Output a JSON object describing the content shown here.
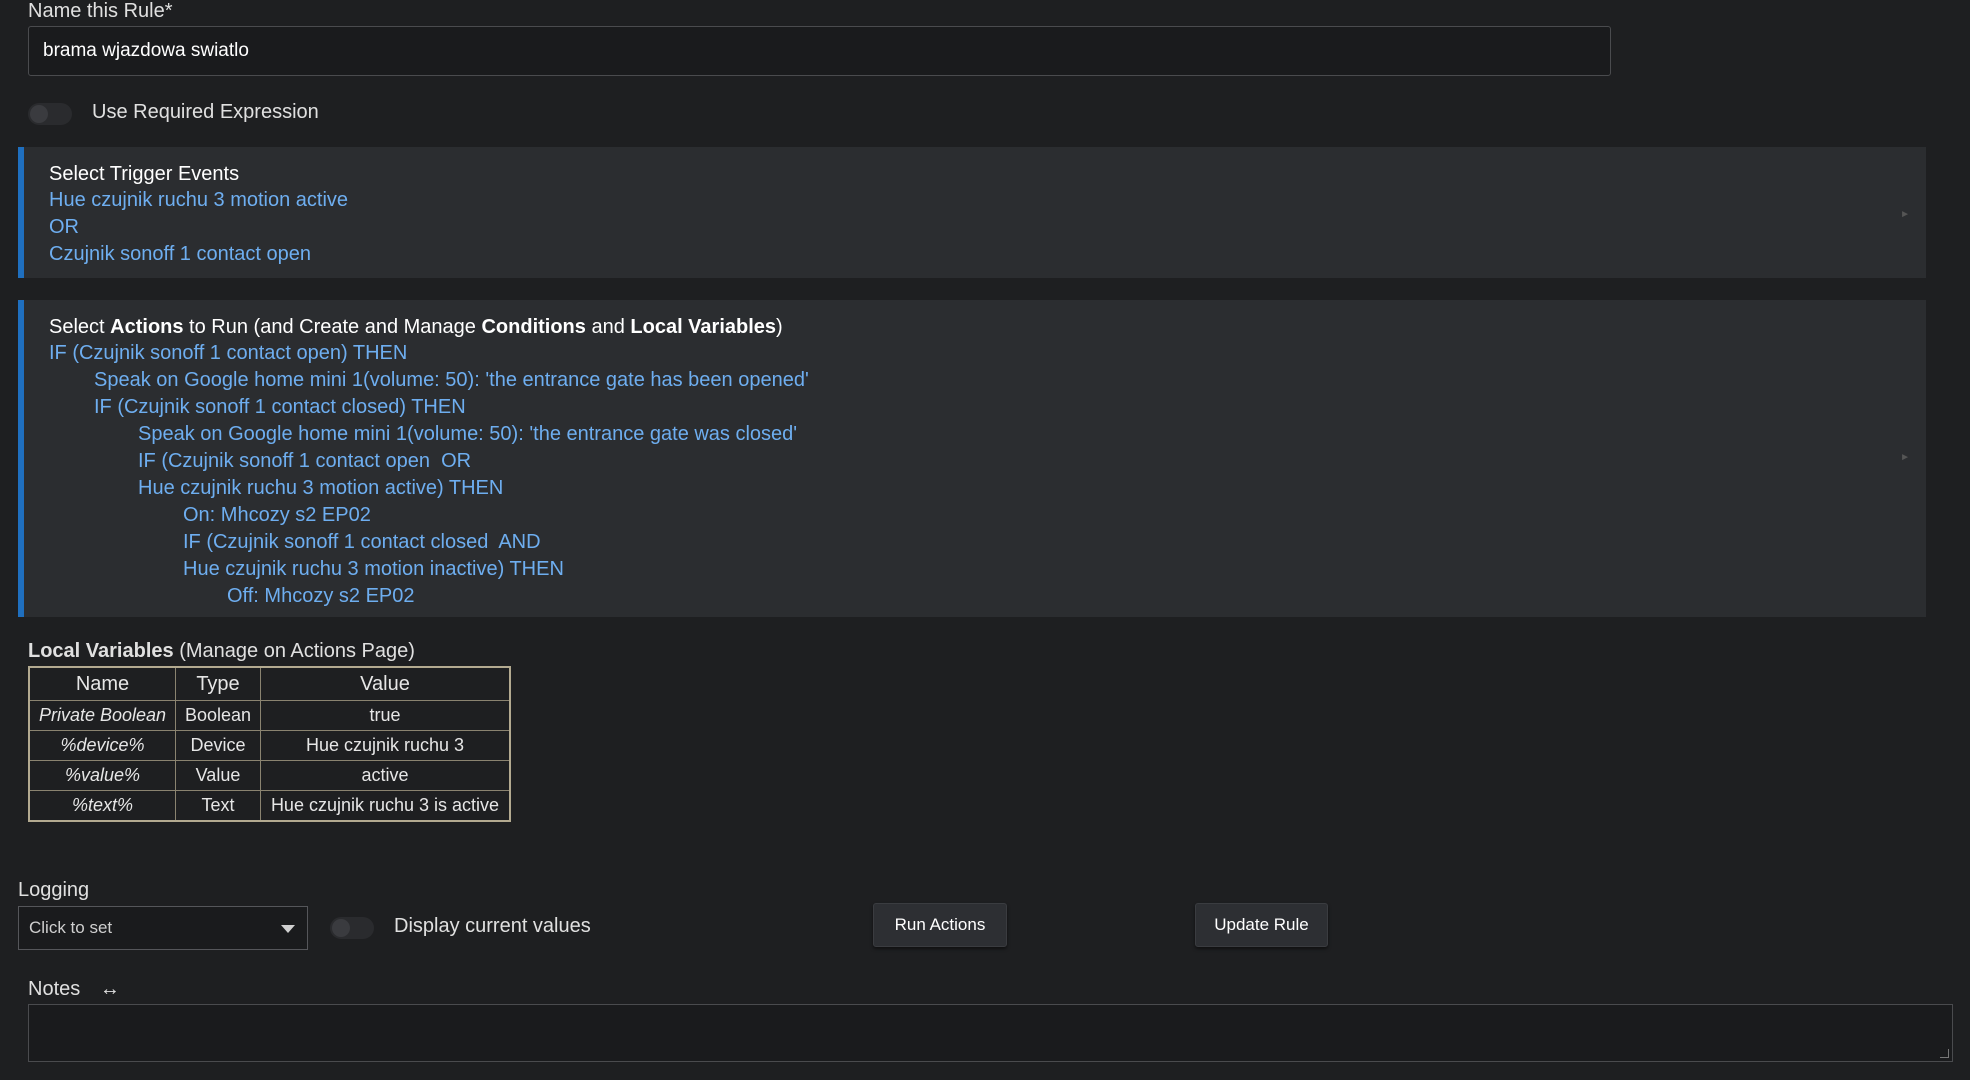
{
  "name_rule": {
    "label": "Name this Rule*",
    "value": "brama wjazdowa swiatlo"
  },
  "required_expression": {
    "label": "Use Required Expression"
  },
  "trigger_panel": {
    "heading": "Select Trigger Events",
    "lines": [
      "Hue czujnik ruchu 3 motion active",
      "OR",
      "Czujnik sonoff 1 contact open"
    ]
  },
  "actions_panel": {
    "heading_select": "Select ",
    "heading_actions": "Actions",
    "heading_mid1": " to Run (and Create and Manage ",
    "heading_conditions": "Conditions",
    "heading_mid2": " and ",
    "heading_locals": "Local Variables",
    "heading_end": ")",
    "lines": [
      "IF (Czujnik sonoff 1 contact open) THEN",
      "Speak on Google home mini 1(volume: 50): 'the entrance gate has been opened'",
      "IF (Czujnik sonoff 1 contact closed) THEN",
      "Speak on Google home mini 1(volume: 50): 'the entrance gate was closed'",
      "IF (Czujnik sonoff 1 contact open  OR",
      "Hue czujnik ruchu 3 motion active) THEN",
      "On: Mhcozy s2 EP02",
      "IF (Czujnik sonoff 1 contact closed  AND",
      "Hue czujnik ruchu 3 motion inactive) THEN",
      "Off: Mhcozy s2 EP02"
    ]
  },
  "local_variables": {
    "title_bold": "Local Variables",
    "title_rest": " (Manage on Actions Page)",
    "headers": [
      "Name",
      "Type",
      "Value"
    ],
    "rows": [
      [
        "Private Boolean",
        "Boolean",
        "true"
      ],
      [
        "%device%",
        "Device",
        "Hue czujnik ruchu 3"
      ],
      [
        "%value%",
        "Value",
        "active"
      ],
      [
        "%text%",
        "Text",
        "Hue czujnik ruchu 3 is active"
      ]
    ]
  },
  "logging": {
    "label": "Logging",
    "selected": "Click to set"
  },
  "display_values": {
    "label": "Display current values"
  },
  "buttons": {
    "run_actions": "Run Actions",
    "update_rule": "Update Rule"
  },
  "notes": {
    "label": "Notes",
    "expand_icon": "↔"
  },
  "colors": {
    "accent": "#1f6fbf",
    "link_text": "#6eaef0",
    "panel_bg": "#2b2d30",
    "page_bg": "#1e1f21"
  }
}
